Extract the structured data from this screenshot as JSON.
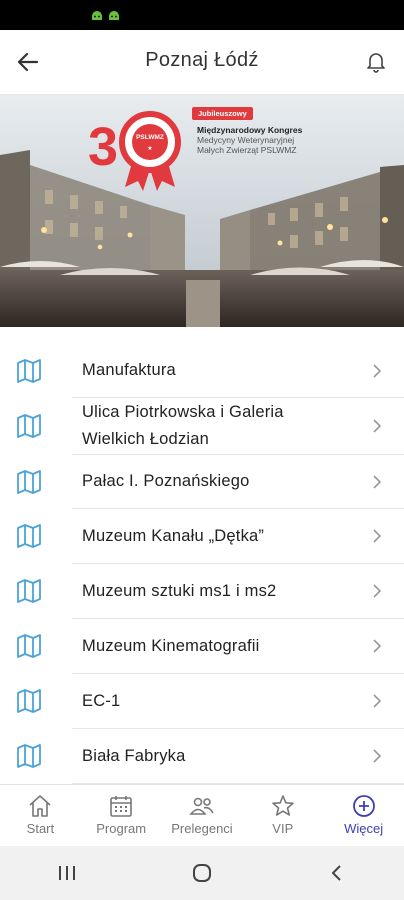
{
  "status_bar": {
    "icons": [
      "android-icon",
      "android-icon"
    ],
    "icon_color": "#6abf3c"
  },
  "app_bar": {
    "title": "Poznaj Łódź",
    "back_icon": "arrow-left-icon",
    "bell_icon": "bell-icon"
  },
  "banner": {
    "logo_number": "30",
    "ribbon_text": "PSLWMZ",
    "badge": "Jubileuszowy",
    "congress_line1": "Międzynarodowy Kongres",
    "congress_line2": "Medycyny Weterynaryjnej",
    "congress_line3": "Małych Zwierząt PSLWMZ",
    "accent_color": "#e03a3e"
  },
  "places": [
    {
      "label": "Manufaktura",
      "icon": "map-icon"
    },
    {
      "label": "Ulica Piotrkowska i Galeria Wielkich Łodzian",
      "icon": "map-icon"
    },
    {
      "label": "Pałac I. Poznańskiego",
      "icon": "map-icon"
    },
    {
      "label": "Muzeum Kanału „Dętka”",
      "icon": "map-icon"
    },
    {
      "label": "Muzeum sztuki ms1 i ms2",
      "icon": "map-icon"
    },
    {
      "label": "Muzeum Kinematografii",
      "icon": "map-icon"
    },
    {
      "label": "EC-1",
      "icon": "map-icon"
    },
    {
      "label": "Biała Fabryka",
      "icon": "map-icon"
    }
  ],
  "map_icon_color": "#4aa3d8",
  "bottom_nav": [
    {
      "label": "Start",
      "icon": "home-icon",
      "active": false
    },
    {
      "label": "Program",
      "icon": "calendar-icon",
      "active": false
    },
    {
      "label": "Prelegenci",
      "icon": "people-icon",
      "active": false
    },
    {
      "label": "VIP",
      "icon": "star-icon",
      "active": false
    },
    {
      "label": "Więcej",
      "icon": "plus-circle-icon",
      "active": true
    }
  ],
  "active_color": "#3b3fb5",
  "system_nav": {
    "recents_icon": "recents-icon",
    "home_icon": "home-circle-icon",
    "back_icon": "back-chevron-icon"
  }
}
